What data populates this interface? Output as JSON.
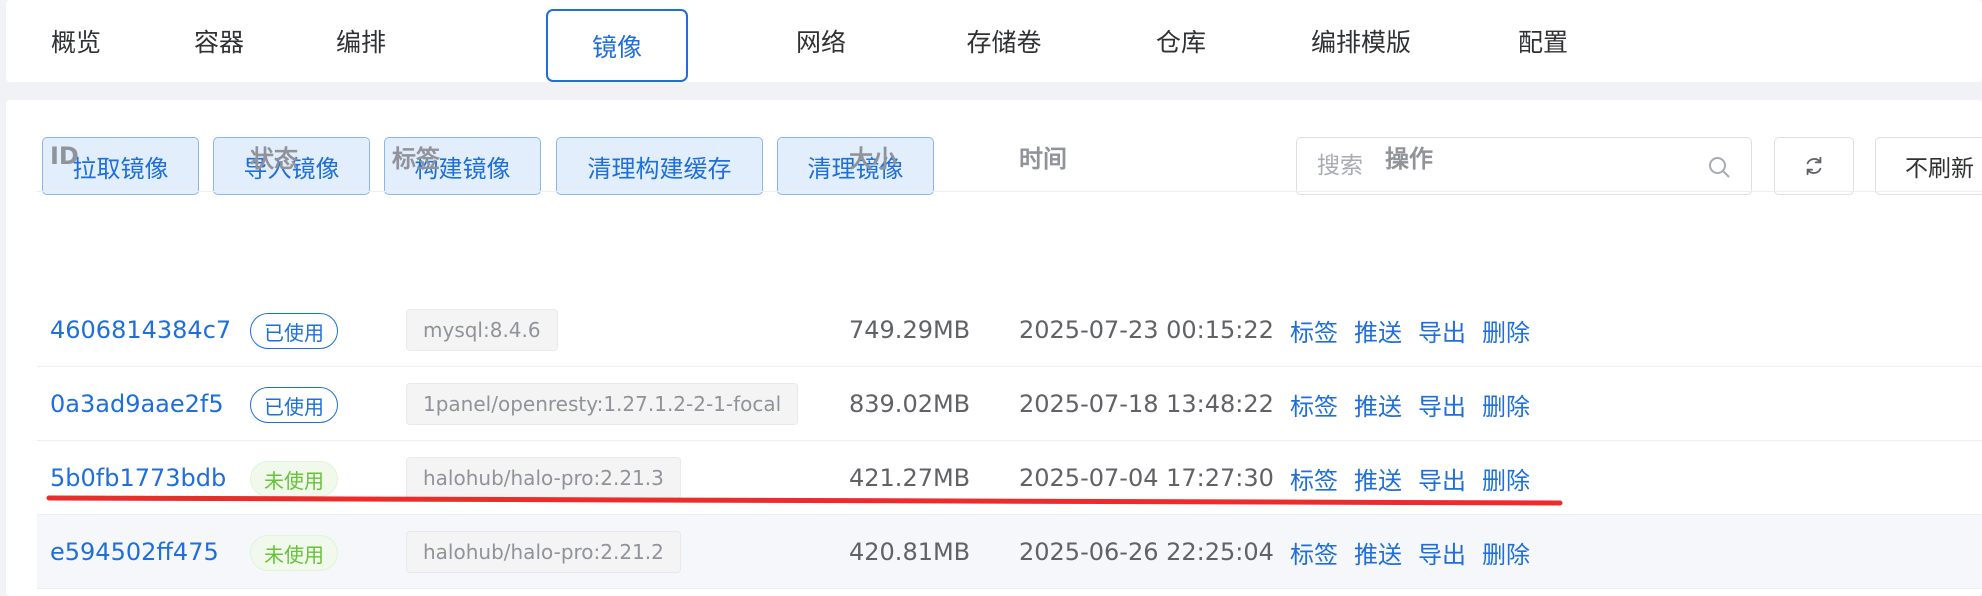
{
  "tabs": [
    {
      "label": "概览"
    },
    {
      "label": "容器"
    },
    {
      "label": "编排"
    },
    {
      "label": "镜像"
    },
    {
      "label": "网络"
    },
    {
      "label": "存储卷"
    },
    {
      "label": "仓库"
    },
    {
      "label": "编排模版"
    },
    {
      "label": "配置"
    }
  ],
  "active_tab": "镜像",
  "toolbar": {
    "pull": "拉取镜像",
    "import": "导入镜像",
    "build": "构建镜像",
    "clean_build_cache": "清理构建缓存",
    "clean_images": "清理镜像",
    "search_placeholder": "搜索",
    "refresh_option": "不刷新"
  },
  "table": {
    "headers": {
      "id": "ID",
      "status": "状态",
      "tags": "标签",
      "size": "大小",
      "time": "时间",
      "actions": "操作"
    },
    "rows": [
      {
        "id": "4606814384c7",
        "status": "已使用",
        "tag": "mysql:8.4.6",
        "size": "749.29MB",
        "time": "2025-07-23 00:15:22"
      },
      {
        "id": "0a3ad9aae2f5",
        "status": "已使用",
        "tag": "1panel/openresty:1.27.1.2-2-1-focal",
        "size": "839.02MB",
        "time": "2025-07-18 13:48:22"
      },
      {
        "id": "5b0fb1773bdb",
        "status": "未使用",
        "tag": "halohub/halo-pro:2.21.3",
        "size": "421.27MB",
        "time": "2025-07-04 17:27:30"
      },
      {
        "id": "e594502ff475",
        "status": "未使用",
        "tag": "halohub/halo-pro:2.21.2",
        "size": "420.81MB",
        "time": "2025-06-26 22:25:04"
      }
    ],
    "row_actions": {
      "tag": "标签",
      "push": "推送",
      "export": "导出",
      "delete": "删除"
    }
  },
  "colors": {
    "primary": "#1e6fd9",
    "used_badge": "#1e6fd9",
    "unused_badge": "#67c23a",
    "annotation_underline": "#ee2b2b"
  }
}
